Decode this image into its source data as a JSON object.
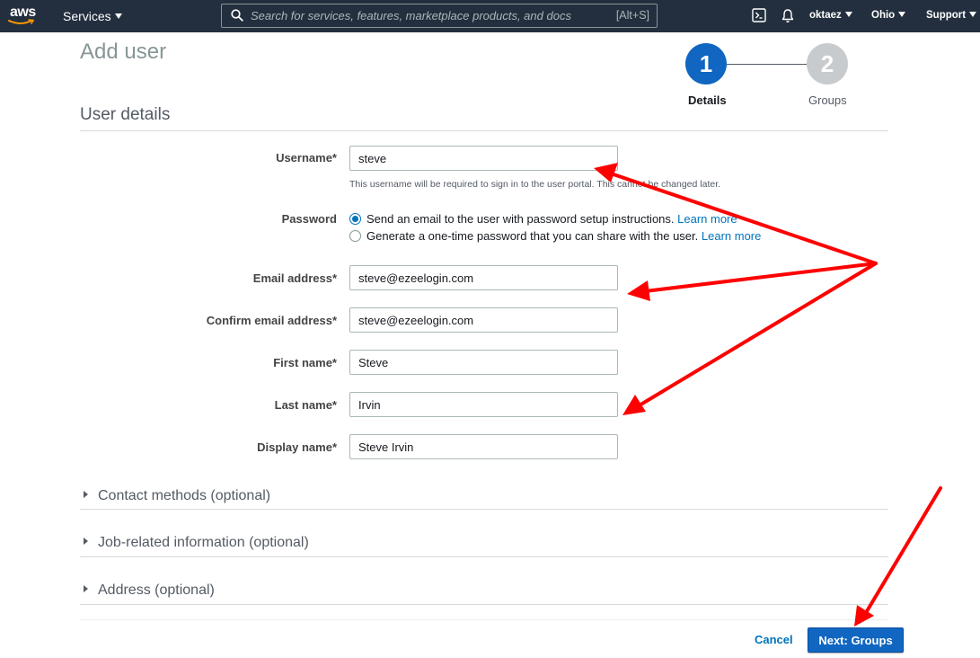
{
  "nav": {
    "logo_text": "aws",
    "services_label": "Services",
    "search_placeholder": "Search for services, features, marketplace products, and docs",
    "search_shortcut": "[Alt+S]",
    "account": "oktaez",
    "region": "Ohio",
    "support": "Support"
  },
  "page": {
    "title": "Add user",
    "steps": [
      {
        "number": "1",
        "label": "Details",
        "state": "active"
      },
      {
        "number": "2",
        "label": "Groups",
        "state": "inactive"
      }
    ],
    "section_title": "User details"
  },
  "form": {
    "username": {
      "label": "Username*",
      "value": "steve",
      "hint": "This username will be required to sign in to the user portal. This cannot be changed later."
    },
    "password": {
      "label": "Password",
      "options": [
        {
          "text": "Send an email to the user with password setup instructions.",
          "link": "Learn more",
          "checked": true
        },
        {
          "text": "Generate a one-time password that you can share with the user.",
          "link": "Learn more",
          "checked": false
        }
      ]
    },
    "email": {
      "label": "Email address*",
      "value": "steve@ezeelogin.com"
    },
    "confirm_email": {
      "label": "Confirm email address*",
      "value": "steve@ezeelogin.com"
    },
    "first_name": {
      "label": "First name*",
      "value": "Steve"
    },
    "last_name": {
      "label": "Last name*",
      "value": "Irvin"
    },
    "display_name": {
      "label": "Display name*",
      "value": "Steve Irvin"
    }
  },
  "sections": [
    {
      "label": "Contact methods (optional)"
    },
    {
      "label": "Job-related information (optional)"
    },
    {
      "label": "Address (optional)"
    }
  ],
  "footer": {
    "cancel_label": "Cancel",
    "next_label": "Next: Groups"
  },
  "colors": {
    "nav_bg": "#232f3e",
    "primary": "#1066c1",
    "link": "#0073bb",
    "annotation_arrow": "#ff0000"
  }
}
